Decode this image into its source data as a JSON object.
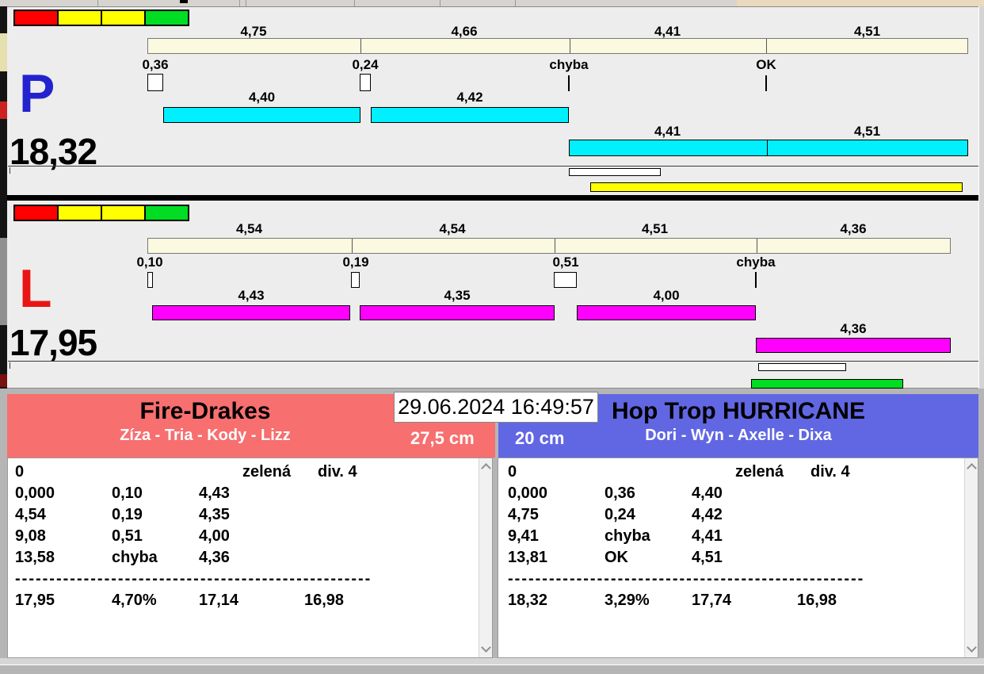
{
  "colors": {
    "cream": "#FCF9E1",
    "cyan": "#00F0FF",
    "magenta": "#FF00FF",
    "yellow": "#FFFF00",
    "green": "#00DD22",
    "block_red": "#FF0000",
    "lane_p_letter": "#2323CE",
    "lane_l_letter": "#E91515",
    "team_left_bg": "#F76F6F",
    "team_right_bg": "#6167E3"
  },
  "datetime": "29.06.2024 16:49:57",
  "lane_p": {
    "letter": "P",
    "total": "18,32",
    "splits": [
      "4,75",
      "4,66",
      "4,41",
      "4,51"
    ],
    "gaps": [
      "0,36",
      "0,24",
      "chyba",
      "OK"
    ],
    "dogs_row1": [
      "4,40",
      "4,42"
    ],
    "dogs_row2": [
      "4,41",
      "4,51"
    ]
  },
  "lane_l": {
    "letter": "L",
    "total": "17,95",
    "splits": [
      "4,54",
      "4,54",
      "4,51",
      "4,36"
    ],
    "gaps": [
      "0,10",
      "0,19",
      "0,51",
      "chyba"
    ],
    "dogs_row1": [
      "4,43",
      "4,35",
      "4,00"
    ],
    "dogs_row2": [
      "4,36"
    ]
  },
  "team_left": {
    "name": "Fire-Drakes",
    "dogs": "Zíza - Tria - Kody - Lizz",
    "height": "27,5 cm",
    "table": {
      "header": {
        "num": "0",
        "color": "zelená",
        "division": "div. 4"
      },
      "rows": [
        [
          "0,000",
          "0,10",
          "4,43"
        ],
        [
          "4,54",
          "0,19",
          "4,35"
        ],
        [
          "9,08",
          "0,51",
          "4,00"
        ],
        [
          "13,58",
          "chyba",
          "4,36"
        ]
      ],
      "separator": "----------------------------------------------------",
      "totals": [
        "17,95",
        "4,70%",
        "17,14",
        "16,98"
      ]
    }
  },
  "team_right": {
    "name": "Hop Trop HURRICANE",
    "dogs": "Dori - Wyn - Axelle - Dixa",
    "height": "20 cm",
    "table": {
      "header": {
        "num": "0",
        "color": "zelená",
        "division": "div. 4"
      },
      "rows": [
        [
          "0,000",
          "0,36",
          "4,40"
        ],
        [
          "4,75",
          "0,24",
          "4,42"
        ],
        [
          "9,41",
          "chyba",
          "4,41"
        ],
        [
          "13,81",
          "OK",
          "4,51"
        ]
      ],
      "separator": "----------------------------------------------------",
      "totals": [
        "18,32",
        "3,29%",
        "17,74",
        "16,98"
      ]
    }
  }
}
